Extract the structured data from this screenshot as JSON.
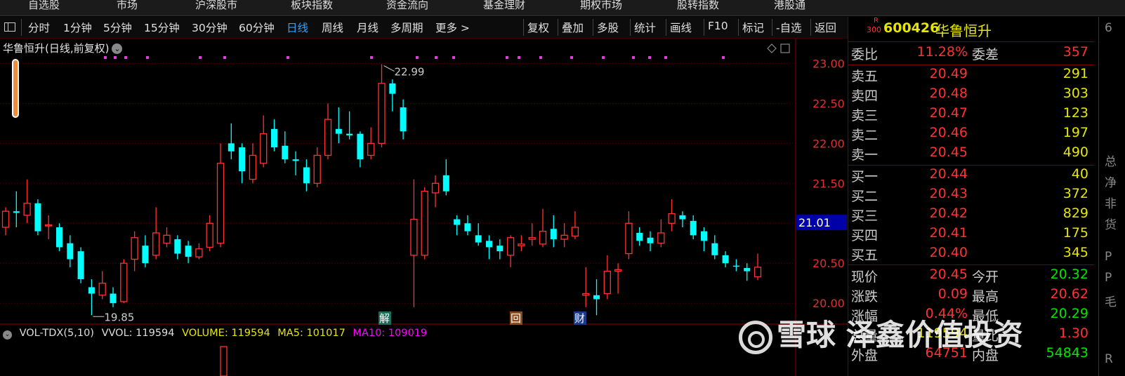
{
  "top_menu": [
    "自选股",
    "市场",
    "沪深股市",
    "板块指数",
    "资金流向",
    "基金理财",
    "期权市场",
    "股转指数",
    "港股通"
  ],
  "toolbar": {
    "periods": [
      "分时",
      "1分钟",
      "5分钟",
      "15分钟",
      "30分钟",
      "60分钟",
      "日线",
      "周线",
      "月线",
      "多周期",
      "更多 >"
    ],
    "active_period": "日线",
    "actions": [
      "复权",
      "叠加",
      "多股",
      "统计",
      "画线",
      "F10",
      "标记",
      "-自选",
      "返回"
    ]
  },
  "chart_title": "华鲁恒升(日线,前复权)",
  "price_axis_labels": [
    "23.00",
    "22.50",
    "22.00",
    "21.50",
    "21.00",
    "20.50",
    "20.00"
  ],
  "current_price_marker": "21.01",
  "high_label": "22.99",
  "low_label": "19.85",
  "event_markers": [
    "解",
    "回",
    "财"
  ],
  "volume_legend": {
    "name": "VOL-TDX(5,10)",
    "vvol": "VVOL: 119594",
    "volume": "VOLUME: 119594",
    "ma5": "MA5: 101017",
    "ma10": "MA10: 109019"
  },
  "colors": {
    "up": "#ff3232",
    "down": "#00ffff",
    "ma5": "#e6e600",
    "ma10": "#ff00ff",
    "accent": "#2aa4ff"
  },
  "quote": {
    "badge_top": "R",
    "badge_bottom": "300",
    "code": "600426",
    "name": "华鲁恒升",
    "wei_bi_label": "委比",
    "wei_bi": "11.28%",
    "wei_cha_label": "委差",
    "wei_cha": "357",
    "asks": [
      {
        "label": "卖五",
        "price": "20.49",
        "vol": "291"
      },
      {
        "label": "卖四",
        "price": "20.48",
        "vol": "303"
      },
      {
        "label": "卖三",
        "price": "20.47",
        "vol": "123"
      },
      {
        "label": "卖二",
        "price": "20.46",
        "vol": "197"
      },
      {
        "label": "卖一",
        "price": "20.45",
        "vol": "490"
      }
    ],
    "bids": [
      {
        "label": "买一",
        "price": "20.44",
        "vol": "40"
      },
      {
        "label": "买二",
        "price": "20.43",
        "vol": "372"
      },
      {
        "label": "买三",
        "price": "20.42",
        "vol": "829"
      },
      {
        "label": "买四",
        "price": "20.41",
        "vol": "175"
      },
      {
        "label": "买五",
        "price": "20.40",
        "vol": "345"
      }
    ],
    "stats": [
      {
        "l1": "现价",
        "v1": "20.45",
        "l2": "今开",
        "v2": "20.32"
      },
      {
        "l1": "涨跌",
        "v1": "0.09",
        "l2": "最高",
        "v2": "20.62"
      },
      {
        "l1": "涨幅",
        "v1": "0.44%",
        "l2": "最低",
        "v2": "20.29"
      },
      {
        "l1": "总量",
        "v1": "119594",
        "l2": "量比",
        "v2": "1.30"
      },
      {
        "l1": "外盘",
        "v1": "64751",
        "l2": "内盘",
        "v2": "54843"
      }
    ]
  },
  "far_right_chars": [
    "6",
    "总",
    "净",
    "非",
    "货",
    "P",
    "P",
    "毛",
    "R"
  ],
  "watermark_text": "雪球 泽鑫价值投资",
  "chart_data": {
    "type": "candlestick",
    "y_axis": {
      "min": 19.8,
      "max": 23.1,
      "ticks": [
        20.0,
        20.5,
        21.0,
        21.5,
        22.0,
        22.5,
        23.0
      ]
    },
    "candles": [
      [
        20.95,
        21.15,
        21.2,
        20.85
      ],
      [
        21.15,
        21.13,
        21.4,
        20.95
      ],
      [
        21.1,
        21.25,
        21.55,
        21.0
      ],
      [
        21.25,
        20.9,
        21.3,
        20.85
      ],
      [
        20.98,
        20.98,
        21.1,
        20.8
      ],
      [
        20.95,
        20.7,
        21.0,
        20.65
      ],
      [
        20.75,
        20.55,
        20.85,
        20.45
      ],
      [
        20.65,
        20.3,
        20.7,
        20.25
      ],
      [
        20.2,
        20.12,
        20.3,
        19.85
      ],
      [
        20.1,
        20.25,
        20.4,
        20.05
      ],
      [
        20.12,
        20.0,
        20.2,
        19.95
      ],
      [
        20.02,
        20.5,
        20.55,
        20.0
      ],
      [
        20.55,
        20.82,
        20.9,
        20.4
      ],
      [
        20.72,
        20.5,
        20.85,
        20.45
      ],
      [
        20.6,
        20.88,
        21.2,
        20.55
      ],
      [
        20.75,
        20.85,
        20.95,
        20.7
      ],
      [
        20.8,
        20.62,
        20.85,
        20.55
      ],
      [
        20.72,
        20.58,
        20.78,
        20.5
      ],
      [
        20.58,
        20.68,
        20.75,
        20.55
      ],
      [
        20.7,
        21.0,
        21.1,
        20.65
      ],
      [
        20.75,
        21.75,
        22.0,
        20.7
      ],
      [
        22.0,
        21.9,
        22.25,
        21.8
      ],
      [
        21.95,
        21.65,
        22.0,
        21.5
      ],
      [
        21.55,
        21.85,
        22.0,
        21.5
      ],
      [
        21.75,
        22.12,
        22.35,
        21.7
      ],
      [
        22.18,
        21.95,
        22.3,
        21.9
      ],
      [
        21.97,
        21.8,
        22.15,
        21.75
      ],
      [
        21.8,
        21.78,
        21.9,
        21.6
      ],
      [
        21.7,
        21.5,
        21.8,
        21.4
      ],
      [
        21.5,
        21.85,
        21.95,
        21.45
      ],
      [
        21.85,
        22.3,
        22.5,
        21.8
      ],
      [
        22.18,
        22.12,
        22.45,
        22.0
      ],
      [
        22.12,
        22.1,
        22.4,
        22.05
      ],
      [
        22.12,
        21.8,
        22.15,
        21.7
      ],
      [
        21.85,
        22.0,
        22.2,
        21.8
      ],
      [
        22.0,
        22.75,
        22.99,
        21.95
      ],
      [
        22.75,
        22.62,
        22.8,
        22.4
      ],
      [
        22.45,
        22.15,
        22.55,
        22.05
      ],
      [
        20.6,
        21.05,
        21.55,
        19.95
      ],
      [
        20.6,
        21.4,
        21.45,
        20.55
      ],
      [
        21.38,
        21.5,
        21.6,
        21.2
      ],
      [
        21.6,
        21.4,
        21.8,
        21.35
      ],
      [
        21.05,
        20.98,
        21.1,
        20.85
      ],
      [
        21.0,
        20.9,
        21.1,
        20.85
      ],
      [
        20.85,
        20.76,
        21.0,
        20.72
      ],
      [
        20.78,
        20.7,
        20.85,
        20.55
      ],
      [
        20.72,
        20.65,
        20.8,
        20.55
      ],
      [
        20.6,
        20.82,
        20.85,
        20.45
      ],
      [
        20.72,
        20.74,
        20.85,
        20.65
      ],
      [
        20.8,
        20.82,
        21.0,
        20.72
      ],
      [
        20.74,
        20.9,
        21.18,
        20.7
      ],
      [
        20.93,
        20.8,
        21.1,
        20.7
      ],
      [
        20.8,
        20.85,
        21.0,
        20.7
      ],
      [
        20.84,
        20.95,
        21.15,
        20.8
      ],
      [
        20.1,
        20.12,
        20.45,
        19.95
      ],
      [
        20.1,
        20.05,
        20.3,
        19.85
      ],
      [
        20.12,
        20.4,
        20.6,
        20.05
      ],
      [
        20.4,
        20.42,
        20.5,
        20.12
      ],
      [
        20.62,
        21.0,
        21.15,
        20.55
      ],
      [
        20.88,
        20.78,
        20.95,
        20.72
      ],
      [
        20.82,
        20.75,
        20.9,
        20.65
      ],
      [
        20.75,
        20.88,
        21.05,
        20.7
      ],
      [
        21.0,
        21.12,
        21.3,
        20.9
      ],
      [
        21.1,
        21.05,
        21.15,
        20.95
      ],
      [
        21.03,
        20.85,
        21.1,
        20.8
      ],
      [
        20.9,
        20.78,
        20.95,
        20.65
      ],
      [
        20.75,
        20.6,
        20.85,
        20.55
      ],
      [
        20.6,
        20.5,
        20.65,
        20.45
      ],
      [
        20.47,
        20.46,
        20.55,
        20.4
      ],
      [
        20.44,
        20.4,
        20.5,
        20.28
      ],
      [
        20.33,
        20.45,
        20.62,
        20.29
      ]
    ]
  }
}
